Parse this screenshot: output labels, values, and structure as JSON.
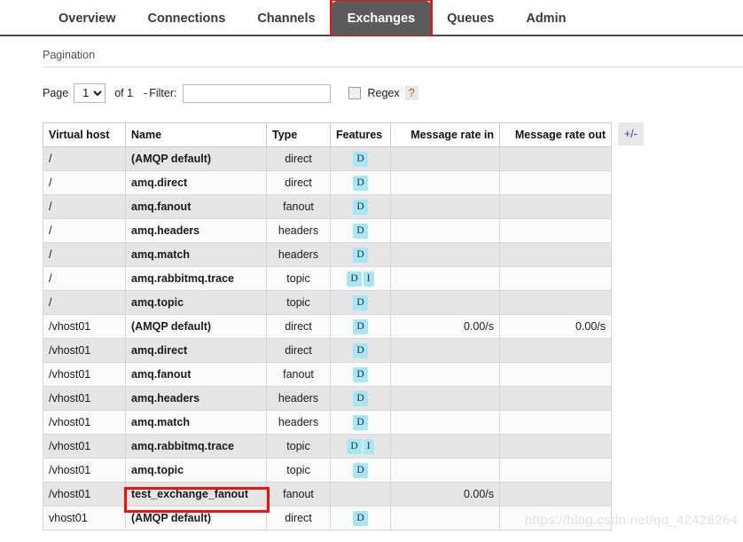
{
  "nav": {
    "tabs": [
      {
        "label": "Overview",
        "active": false
      },
      {
        "label": "Connections",
        "active": false
      },
      {
        "label": "Channels",
        "active": false
      },
      {
        "label": "Exchanges",
        "active": true
      },
      {
        "label": "Queues",
        "active": false
      },
      {
        "label": "Admin",
        "active": false
      }
    ],
    "active_tab": "Exchanges",
    "highlight_color": "#ee1111",
    "active_tab_bg": "#5b5b5b"
  },
  "section": {
    "title": "Pagination"
  },
  "pagination": {
    "page_label": "Page",
    "page_value": "1",
    "page_options": [
      "1"
    ],
    "of_label": "of 1",
    "dash": "-",
    "filter_label": "Filter:",
    "filter_value": "",
    "filter_placeholder": "",
    "regex_label": "Regex",
    "regex_checked": false,
    "help_label": "?"
  },
  "table": {
    "columns": [
      "Virtual host",
      "Name",
      "Type",
      "Features",
      "Message rate in",
      "Message rate out"
    ],
    "toggle_columns_label": "+/-",
    "badge_colors": {
      "background": "#a9e6f5",
      "text": "#16313a"
    },
    "rows": [
      {
        "vhost": "/",
        "name": "(AMQP default)",
        "type": "direct",
        "features": [
          "D"
        ],
        "rate_in": "",
        "rate_out": ""
      },
      {
        "vhost": "/",
        "name": "amq.direct",
        "type": "direct",
        "features": [
          "D"
        ],
        "rate_in": "",
        "rate_out": ""
      },
      {
        "vhost": "/",
        "name": "amq.fanout",
        "type": "fanout",
        "features": [
          "D"
        ],
        "rate_in": "",
        "rate_out": ""
      },
      {
        "vhost": "/",
        "name": "amq.headers",
        "type": "headers",
        "features": [
          "D"
        ],
        "rate_in": "",
        "rate_out": ""
      },
      {
        "vhost": "/",
        "name": "amq.match",
        "type": "headers",
        "features": [
          "D"
        ],
        "rate_in": "",
        "rate_out": ""
      },
      {
        "vhost": "/",
        "name": "amq.rabbitmq.trace",
        "type": "topic",
        "features": [
          "D",
          "I"
        ],
        "rate_in": "",
        "rate_out": ""
      },
      {
        "vhost": "/",
        "name": "amq.topic",
        "type": "topic",
        "features": [
          "D"
        ],
        "rate_in": "",
        "rate_out": ""
      },
      {
        "vhost": "/vhost01",
        "name": "(AMQP default)",
        "type": "direct",
        "features": [
          "D"
        ],
        "rate_in": "0.00/s",
        "rate_out": "0.00/s"
      },
      {
        "vhost": "/vhost01",
        "name": "amq.direct",
        "type": "direct",
        "features": [
          "D"
        ],
        "rate_in": "",
        "rate_out": ""
      },
      {
        "vhost": "/vhost01",
        "name": "amq.fanout",
        "type": "fanout",
        "features": [
          "D"
        ],
        "rate_in": "",
        "rate_out": ""
      },
      {
        "vhost": "/vhost01",
        "name": "amq.headers",
        "type": "headers",
        "features": [
          "D"
        ],
        "rate_in": "",
        "rate_out": ""
      },
      {
        "vhost": "/vhost01",
        "name": "amq.match",
        "type": "headers",
        "features": [
          "D"
        ],
        "rate_in": "",
        "rate_out": ""
      },
      {
        "vhost": "/vhost01",
        "name": "amq.rabbitmq.trace",
        "type": "topic",
        "features": [
          "D",
          "I"
        ],
        "rate_in": "",
        "rate_out": ""
      },
      {
        "vhost": "/vhost01",
        "name": "amq.topic",
        "type": "topic",
        "features": [
          "D"
        ],
        "rate_in": "",
        "rate_out": ""
      },
      {
        "vhost": "/vhost01",
        "name": "test_exchange_fanout",
        "type": "fanout",
        "features": [],
        "rate_in": "0.00/s",
        "rate_out": "",
        "highlighted": true
      },
      {
        "vhost": "vhost01",
        "name": "(AMQP default)",
        "type": "direct",
        "features": [
          "D"
        ],
        "rate_in": "",
        "rate_out": ""
      }
    ]
  },
  "watermark": {
    "text": "https://blog.csdn.net/qq_42428264"
  }
}
